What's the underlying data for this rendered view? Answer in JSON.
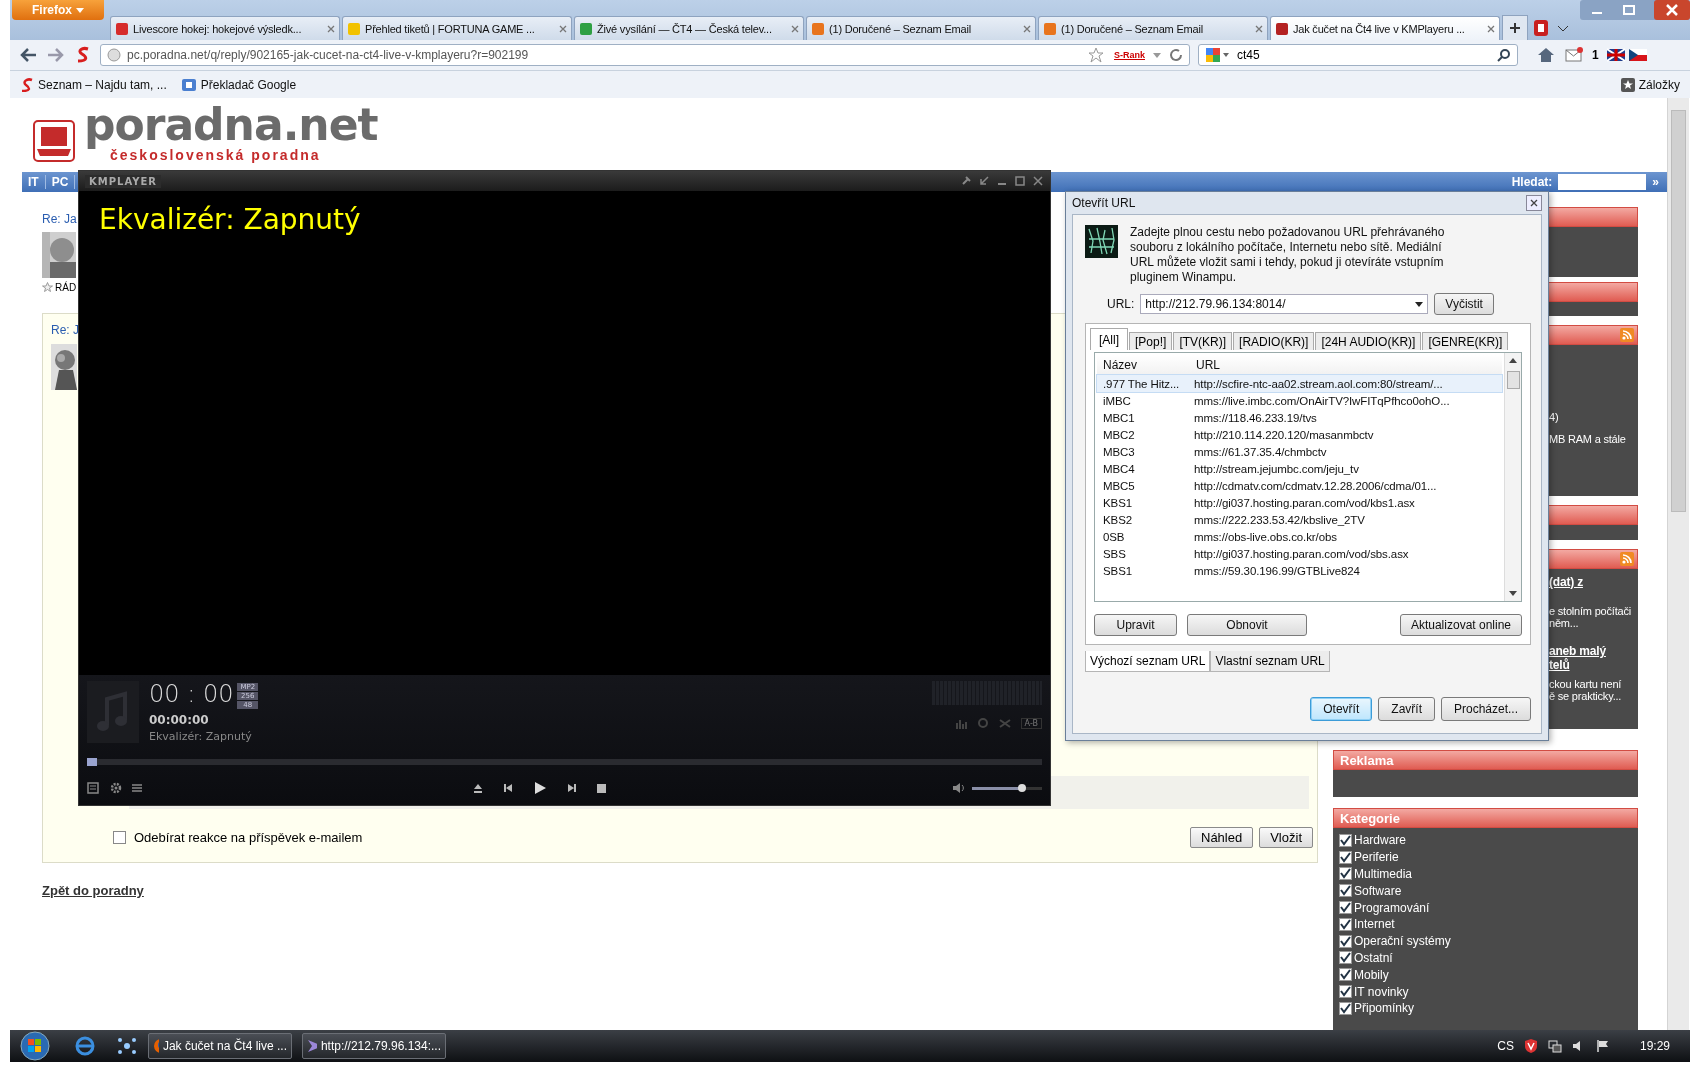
{
  "browser": {
    "menu_button": "Firefox",
    "tabs": [
      {
        "label": "Livescore hokej: hokejové výsledk...",
        "selected": false
      },
      {
        "label": "Přehled tiketů | FORTUNA GAME ...",
        "selected": false
      },
      {
        "label": "Živé vysílání — ČT4 — Česká telev...",
        "selected": false
      },
      {
        "label": "(1) Doručené – Seznam Email",
        "selected": false
      },
      {
        "label": "(1) Doručené – Seznam Email",
        "selected": false
      },
      {
        "label": "Jak čučet na Čt4 live v KMPlayeru ...",
        "selected": true
      }
    ],
    "address": "pc.poradna.net/q/reply/902165-jak-cucet-na-ct4-live-v-kmplayeru?r=902199",
    "rank_badge": "S-Rank",
    "search": "ct45",
    "mail_count": "1",
    "bookmarks": [
      "Seznam – Najdu tam, ...",
      "Překladač Google"
    ],
    "bookmarks_menu": "Záložky"
  },
  "page": {
    "logo": {
      "name": "poradna.net",
      "tagline": "československá poradna"
    },
    "nav": [
      "IT",
      "PC"
    ],
    "search_label": "Hledat:",
    "search_go": "»",
    "post_title": "Re: Ja",
    "rank": "RÁD",
    "reply_title": "Re: J",
    "subscribe": {
      "label": "Odebírat reakce na příspěvek e-mailem",
      "checked": false
    },
    "buttons": [
      "Náhled",
      "Vložit"
    ],
    "back_link": "Zpět do poradny",
    "sidebar": {
      "blocks": [
        {
          "rss": false
        },
        {
          "rss": false
        },
        {
          "rss": true,
          "lines": [
            {
              "kind": "text",
              "text": "4)"
            },
            {
              "kind": "text",
              "text": "MB RAM a stále"
            }
          ]
        },
        {
          "rss": false
        },
        {
          "rss": true,
          "lines": [
            {
              "kind": "link",
              "text": "(dat) z"
            },
            {
              "kind": "text",
              "text": "e stolním počítači"
            },
            {
              "kind": "text",
              "text": "něm..."
            },
            {
              "kind": "link",
              "text": "aneb malý"
            },
            {
              "kind": "link",
              "text": "telů"
            },
            {
              "kind": "text",
              "text": "ckou kartu není"
            },
            {
              "kind": "text",
              "text": "ě se prakticky..."
            }
          ]
        }
      ],
      "ads_title": "Reklama",
      "categories_title": "Kategorie",
      "categories": [
        {
          "label": "Hardware",
          "checked": true
        },
        {
          "label": "Periferie",
          "checked": true
        },
        {
          "label": "Multimedia",
          "checked": true
        },
        {
          "label": "Software",
          "checked": true
        },
        {
          "label": "Programování",
          "checked": true
        },
        {
          "label": "Internet",
          "checked": true
        },
        {
          "label": "Operační systémy",
          "checked": true
        },
        {
          "label": "Ostatní",
          "checked": true
        },
        {
          "label": "Mobily",
          "checked": true
        },
        {
          "label": "IT novinky",
          "checked": true
        },
        {
          "label": "Připomínky",
          "checked": true
        }
      ]
    }
  },
  "player": {
    "logo": "KMPLAYER",
    "osd": "Ekvalizér: Zapnutý",
    "clock": "00 : 00",
    "codec_badges": [
      "MP2",
      "256",
      "48"
    ],
    "elapsed": "00:00:00",
    "status": "Ekvalizér: Zapnutý",
    "ab_label": "A-B",
    "seek": {
      "level": 0
    },
    "volume": {
      "level": 0.72
    }
  },
  "dialog": {
    "title": "Otevřít URL",
    "description": "Zadejte plnou cestu nebo požadovanou URL přehrávaného souboru z lokálního počítače, Internetu nebo sítě. Mediální URL můžete vložit sami i tehdy, pokud ji otevíráte vstupním pluginem Winampu.",
    "url_label": "URL:",
    "url_value": "http://212.79.96.134:8014/",
    "clear_button": "Vyčistit",
    "tabs": [
      {
        "label": "[All]",
        "selected": true
      },
      {
        "label": "[Pop!]",
        "selected": false
      },
      {
        "label": "[TV(KR)]",
        "selected": false
      },
      {
        "label": "[RADIO(KR)]",
        "selected": false
      },
      {
        "label": "[24H AUDIO(KR)]",
        "selected": false
      },
      {
        "label": "[GENRE(KR)]",
        "selected": false
      }
    ],
    "columns": [
      "Název",
      "URL"
    ],
    "rows": [
      {
        "name": ".977 The Hitz...",
        "url": "http://scfire-ntc-aa02.stream.aol.com:80/stream/...",
        "selected": true
      },
      {
        "name": "iMBC",
        "url": "mms://live.imbc.com/OnAirTV?IwFITqPfhco0ohO...",
        "selected": false
      },
      {
        "name": "MBC1",
        "url": "mms://118.46.233.19/tvs",
        "selected": false
      },
      {
        "name": "MBC2",
        "url": "http://210.114.220.120/masanmbctv",
        "selected": false
      },
      {
        "name": "MBC3",
        "url": "mms://61.37.35.4/chmbctv",
        "selected": false
      },
      {
        "name": "MBC4",
        "url": "http://stream.jejumbc.com/jeju_tv",
        "selected": false
      },
      {
        "name": "MBC5",
        "url": "http://cdmatv.com/cdmatv.12.28.2006/cdma/01...",
        "selected": false
      },
      {
        "name": "KBS1",
        "url": "http://gi037.hosting.paran.com/vod/kbs1.asx",
        "selected": false
      },
      {
        "name": "KBS2",
        "url": "mms://222.233.53.42/kbslive_2TV",
        "selected": false
      },
      {
        "name": "0SB",
        "url": "mms://obs-live.obs.co.kr/obs",
        "selected": false
      },
      {
        "name": "SBS",
        "url": "http://gi037.hosting.paran.com/vod/sbs.asx",
        "selected": false
      },
      {
        "name": "SBS1",
        "url": "mms://59.30.196.99/GTBLive824",
        "selected": false
      }
    ],
    "list_buttons": [
      "Upravit",
      "Obnovit",
      "Aktualizovat online"
    ],
    "list_tabs": [
      {
        "label": "Výchozí seznam URL",
        "selected": true
      },
      {
        "label": "Vlastní seznam URL",
        "selected": false
      }
    ],
    "buttons": [
      {
        "label": "Otevřít",
        "default": true
      },
      {
        "label": "Zavřít",
        "default": false
      },
      {
        "label": "Procházet...",
        "default": false
      }
    ]
  },
  "taskbar": {
    "windows": [
      "Jak čučet na Čt4 live ...",
      "http://212.79.96.134:..."
    ],
    "language": "CS",
    "clock": "19:29"
  }
}
